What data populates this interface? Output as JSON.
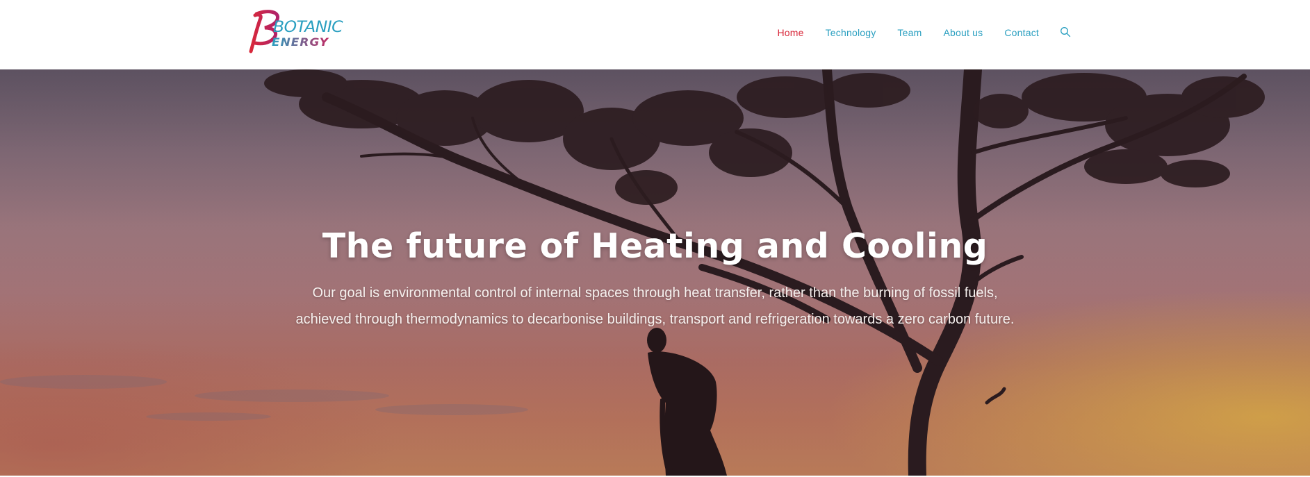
{
  "brand": {
    "logo_line1": "BOTANIC",
    "logo_line2": "ENERGY",
    "colors": {
      "primary": "#d8283a",
      "secondary": "#2a9fc0"
    }
  },
  "nav": {
    "items": [
      {
        "label": "Home",
        "active": true
      },
      {
        "label": "Technology",
        "active": false
      },
      {
        "label": "Team",
        "active": false
      },
      {
        "label": "About us",
        "active": false
      },
      {
        "label": "Contact",
        "active": false
      }
    ],
    "search_icon": "search-icon"
  },
  "hero": {
    "title": "The future of Heating and Cooling",
    "text_line1": "Our goal is environmental control of internal spaces through heat transfer, rather than the burning of fossil fuels,",
    "text_line2": "achieved through thermodynamics to decarbonise buildings, transport and refrigeration towards a zero carbon future."
  }
}
